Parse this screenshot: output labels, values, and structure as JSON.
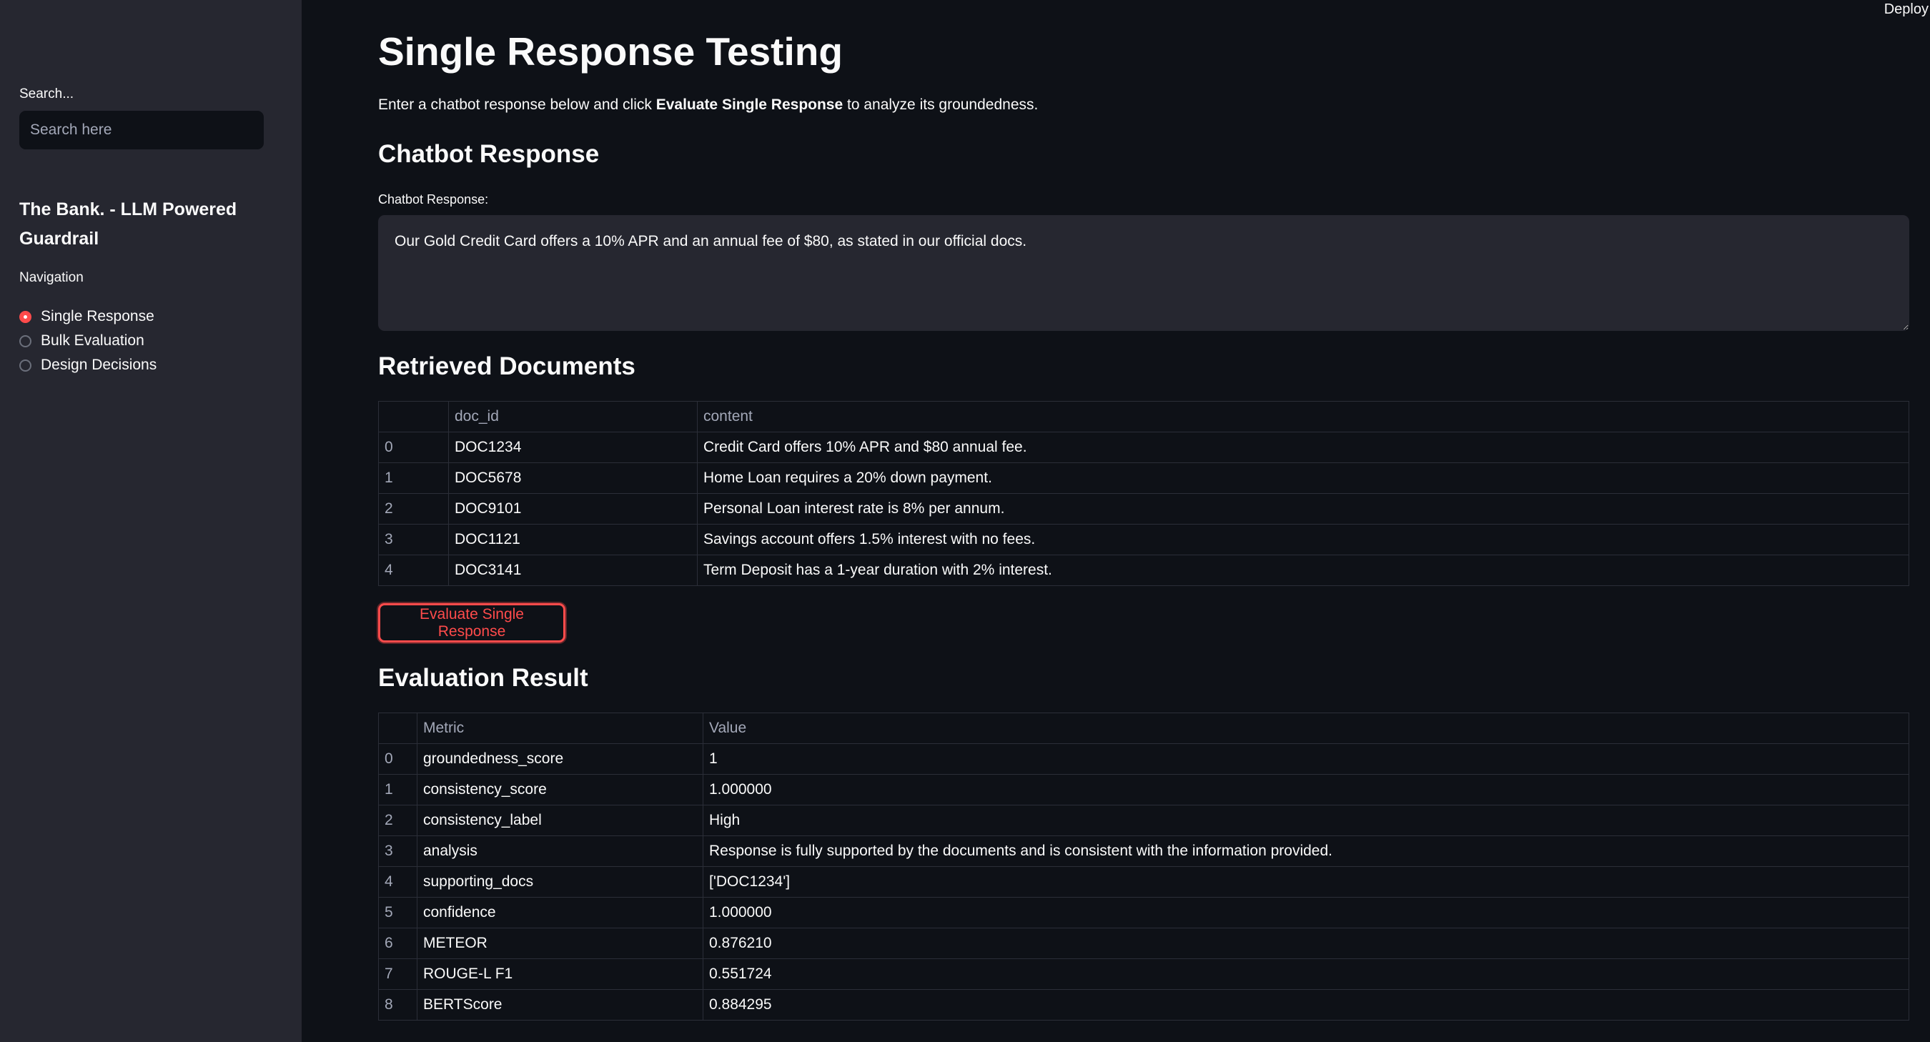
{
  "header": {
    "deploy_label": "Deploy"
  },
  "sidebar": {
    "search_label": "Search...",
    "search_placeholder": "Search here",
    "app_title": "The Bank. - LLM Powered Guardrail",
    "nav_label": "Navigation",
    "items": [
      {
        "label": "Single Response",
        "selected": true
      },
      {
        "label": "Bulk Evaluation",
        "selected": false
      },
      {
        "label": "Design Decisions",
        "selected": false
      }
    ]
  },
  "main": {
    "title": "Single Response Testing",
    "intro_before": "Enter a chatbot response below and click ",
    "intro_bold": "Evaluate Single Response",
    "intro_after": " to analyze its groundedness.",
    "chatbot_section_title": "Chatbot Response",
    "chatbot_field_label": "Chatbot Response:",
    "chatbot_response_value": "Our Gold Credit Card offers a 10% APR and an annual fee of $80, as stated in our official docs.",
    "retrieved_section_title": "Retrieved Documents",
    "retrieved_table": {
      "columns": [
        "",
        "doc_id",
        "content"
      ],
      "rows": [
        [
          "0",
          "DOC1234",
          "Credit Card offers 10% APR and $80 annual fee."
        ],
        [
          "1",
          "DOC5678",
          "Home Loan requires a 20% down payment."
        ],
        [
          "2",
          "DOC9101",
          "Personal Loan interest rate is 8% per annum."
        ],
        [
          "3",
          "DOC1121",
          "Savings account offers 1.5% interest with no fees."
        ],
        [
          "4",
          "DOC3141",
          "Term Deposit has a 1-year duration with 2% interest."
        ]
      ]
    },
    "evaluate_button_label": "Evaluate Single Response",
    "evaluation_section_title": "Evaluation Result",
    "evaluation_table": {
      "columns": [
        "",
        "Metric",
        "Value"
      ],
      "rows": [
        [
          "0",
          "groundedness_score",
          "1"
        ],
        [
          "1",
          "consistency_score",
          "1.000000"
        ],
        [
          "2",
          "consistency_label",
          "High"
        ],
        [
          "3",
          "analysis",
          "Response is fully supported by the documents and is consistent with the information provided."
        ],
        [
          "4",
          "supporting_docs",
          "['DOC1234']"
        ],
        [
          "5",
          "confidence",
          "1.000000"
        ],
        [
          "6",
          "METEOR",
          "0.876210"
        ],
        [
          "7",
          "ROUGE-L F1",
          "0.551724"
        ],
        [
          "8",
          "BERTScore",
          "0.884295"
        ]
      ]
    }
  },
  "colors": {
    "background": "#0e1117",
    "sidebar": "#262730",
    "accent": "#ff4b4b",
    "text": "#fafafa",
    "muted_text": "#a3a8b8"
  }
}
